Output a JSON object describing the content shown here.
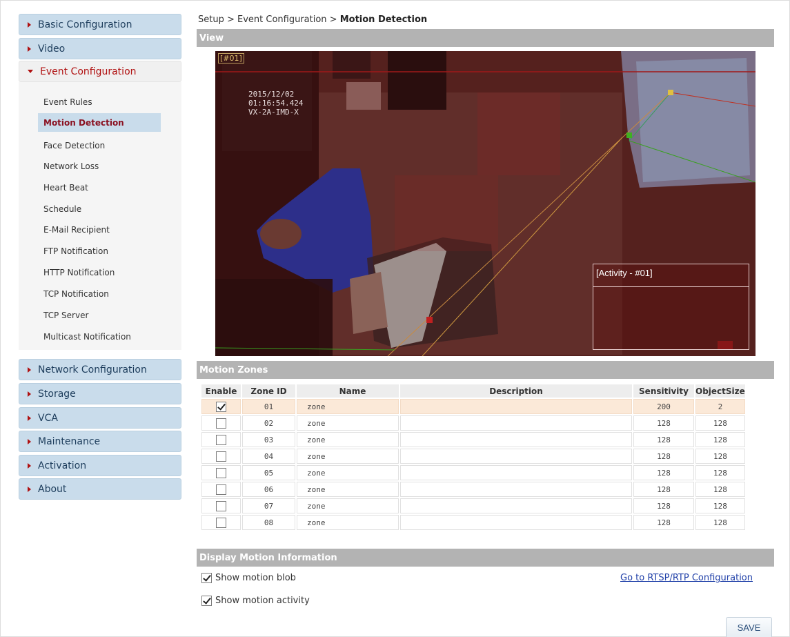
{
  "sidebar": {
    "top_items": [
      {
        "label": "Basic Configuration"
      },
      {
        "label": "Video"
      },
      {
        "label": "Event Configuration"
      }
    ],
    "sub_items": [
      {
        "label": "Event Rules"
      },
      {
        "label": "Motion Detection"
      },
      {
        "label": "Face Detection"
      },
      {
        "label": "Network Loss"
      },
      {
        "label": "Heart Beat"
      },
      {
        "label": "Schedule"
      },
      {
        "label": "E-Mail Recipient"
      },
      {
        "label": "FTP Notification"
      },
      {
        "label": "HTTP Notification"
      },
      {
        "label": "TCP Notification"
      },
      {
        "label": "TCP Server"
      },
      {
        "label": "Multicast Notification"
      }
    ],
    "bottom_items": [
      {
        "label": "Network Configuration"
      },
      {
        "label": "Storage"
      },
      {
        "label": "VCA"
      },
      {
        "label": "Maintenance"
      },
      {
        "label": "Activation"
      },
      {
        "label": "About"
      }
    ]
  },
  "breadcrumb": {
    "prefix": "Setup > Event Configuration > ",
    "current": "Motion Detection"
  },
  "view": {
    "title": "View",
    "camera_id": "[#01]",
    "osd": {
      "date": "2015/12/02",
      "time": "01:16:54.424",
      "camera": "VX-2A-IMD-X"
    },
    "activity_label": "[Activity - #01]"
  },
  "zones": {
    "title": "Motion Zones",
    "columns": {
      "enable": "Enable",
      "zone_id": "Zone ID",
      "name": "Name",
      "description": "Description",
      "sensitivity": "Sensitivity",
      "object_size": "ObjectSize"
    },
    "rows": [
      {
        "enabled": true,
        "id": "01",
        "name": "zone",
        "description": "",
        "sensitivity": "200",
        "object_size": "2"
      },
      {
        "enabled": false,
        "id": "02",
        "name": "zone",
        "description": "",
        "sensitivity": "128",
        "object_size": "128"
      },
      {
        "enabled": false,
        "id": "03",
        "name": "zone",
        "description": "",
        "sensitivity": "128",
        "object_size": "128"
      },
      {
        "enabled": false,
        "id": "04",
        "name": "zone",
        "description": "",
        "sensitivity": "128",
        "object_size": "128"
      },
      {
        "enabled": false,
        "id": "05",
        "name": "zone",
        "description": "",
        "sensitivity": "128",
        "object_size": "128"
      },
      {
        "enabled": false,
        "id": "06",
        "name": "zone",
        "description": "",
        "sensitivity": "128",
        "object_size": "128"
      },
      {
        "enabled": false,
        "id": "07",
        "name": "zone",
        "description": "",
        "sensitivity": "128",
        "object_size": "128"
      },
      {
        "enabled": false,
        "id": "08",
        "name": "zone",
        "description": "",
        "sensitivity": "128",
        "object_size": "128"
      }
    ]
  },
  "display": {
    "title": "Display Motion Information",
    "show_blob": {
      "label": "Show motion blob",
      "checked": true
    },
    "show_activity": {
      "label": "Show motion activity",
      "checked": true
    },
    "rtsp_link": "Go to RTSP/RTP Configuration"
  },
  "save_label": "SAVE",
  "colors": {
    "menu_bg": "#c9dceb",
    "accent": "#b01010",
    "section_bar": "#b3b3b3",
    "link": "#1f3fa8"
  }
}
